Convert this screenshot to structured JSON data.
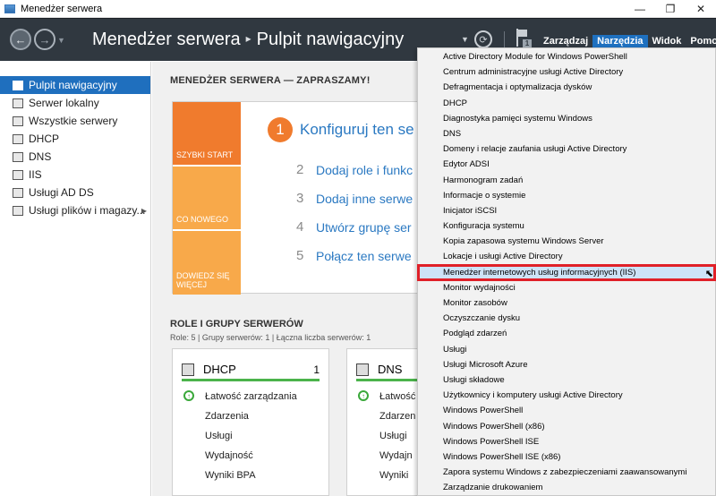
{
  "window": {
    "title": "Menedżer serwera",
    "controls": [
      "—",
      "❐",
      "✕"
    ]
  },
  "header": {
    "breadcrumb_root": "Menedżer serwera",
    "breadcrumb_sep": "▸",
    "breadcrumb_page": "Pulpit nawigacyjny",
    "notification_count": "1",
    "menus": [
      {
        "label": "Zarządzaj",
        "active": false
      },
      {
        "label": "Narzędzia",
        "active": true
      },
      {
        "label": "Widok",
        "active": false
      },
      {
        "label": "Pomoc",
        "active": false
      }
    ]
  },
  "sidebar": {
    "items": [
      {
        "label": "Pulpit nawigacyjny",
        "icon": "dashboard-icon",
        "active": true
      },
      {
        "label": "Serwer lokalny",
        "icon": "server-icon",
        "active": false
      },
      {
        "label": "Wszystkie serwery",
        "icon": "servers-icon",
        "active": false
      },
      {
        "label": "DHCP",
        "icon": "dhcp-icon",
        "active": false
      },
      {
        "label": "DNS",
        "icon": "dns-icon",
        "active": false
      },
      {
        "label": "IIS",
        "icon": "iis-icon",
        "active": false
      },
      {
        "label": "Usługi AD DS",
        "icon": "adds-icon",
        "active": false
      },
      {
        "label": "Usługi plików i magazy...",
        "icon": "storage-icon",
        "active": false,
        "expandable": true
      }
    ]
  },
  "main": {
    "welcome": "MENEDŻER SERWERA — ZAPRASZAMY!",
    "quick_start": {
      "tiles": [
        "SZYBKI START",
        "CO NOWEGO",
        "DOWIEDZ SIĘ WIĘCEJ"
      ],
      "step1": {
        "num": "1",
        "label": "Konfiguruj ten se"
      },
      "steps": [
        {
          "num": "2",
          "label": "Dodaj role i funkc"
        },
        {
          "num": "3",
          "label": "Dodaj inne serwe"
        },
        {
          "num": "4",
          "label": "Utwórz grupę ser"
        },
        {
          "num": "5",
          "label": "Połącz ten serwe"
        }
      ]
    },
    "roles": {
      "title": "ROLE I GRUPY SERWERÓW",
      "subtitle": "Role: 5 | Grupy serwerów: 1 | Łączna liczba serwerów: 1",
      "cards": [
        {
          "name": "DHCP",
          "count": "1",
          "rows": [
            "Łatwość zarządzania",
            "Zdarzenia",
            "Usługi",
            "Wydajność",
            "Wyniki BPA"
          ]
        },
        {
          "name": "DNS",
          "count": "",
          "rows": [
            "Łatwość",
            "Zdarzen",
            "Usługi",
            "Wydajn",
            "Wyniki"
          ]
        }
      ]
    }
  },
  "tools_menu": {
    "items": [
      "Active Directory Module for Windows PowerShell",
      "Centrum administracyjne usługi Active Directory",
      "Defragmentacja i optymalizacja dysków",
      "DHCP",
      "Diagnostyka pamięci systemu Windows",
      "DNS",
      "Domeny i relacje zaufania usługi Active Directory",
      "Edytor ADSI",
      "Harmonogram zadań",
      "Informacje o systemie",
      "Inicjator iSCSI",
      "Konfiguracja systemu",
      "Kopia zapasowa systemu Windows Server",
      "Lokacje i usługi Active Directory",
      "Menedżer internetowych usług informacyjnych (IIS)",
      "Monitor wydajności",
      "Monitor zasobów",
      "Oczyszczanie dysku",
      "Podgląd zdarzeń",
      "Usługi",
      "Usługi Microsoft Azure",
      "Usługi składowe",
      "Użytkownicy i komputery usługi Active Directory",
      "Windows PowerShell",
      "Windows PowerShell (x86)",
      "Windows PowerShell ISE",
      "Windows PowerShell ISE (x86)",
      "Zapora systemu Windows z zabezpieczeniami zaawansowanymi",
      "Zarządzanie drukowaniem"
    ],
    "highlighted_index": 14
  }
}
